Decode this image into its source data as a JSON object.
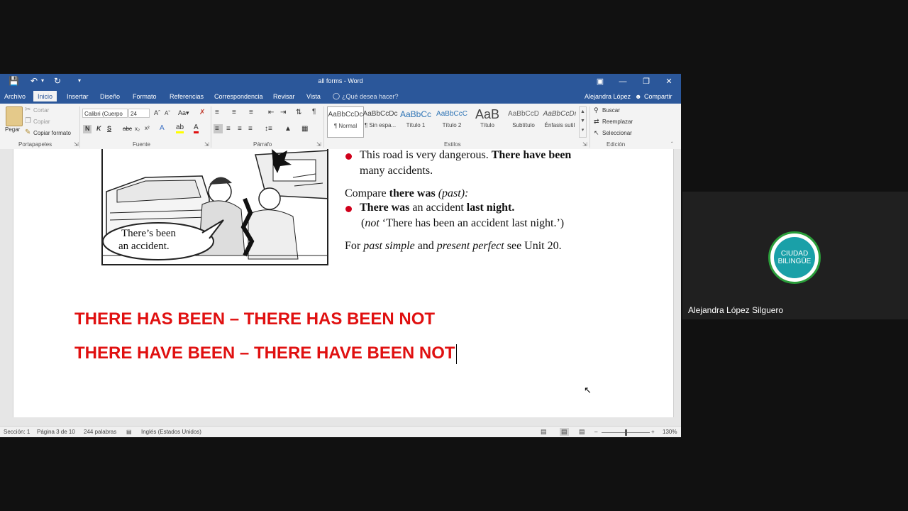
{
  "window": {
    "title": "all forms - Word"
  },
  "tabs": [
    "Archivo",
    "Inicio",
    "Insertar",
    "Diseño",
    "Formato",
    "Referencias",
    "Correspondencia",
    "Revisar",
    "Vista"
  ],
  "tell_me": "¿Qué desea hacer?",
  "user": "Alejandra López",
  "share": "Compartir",
  "ribbon": {
    "clipboard": {
      "paste": "Pegar",
      "cut": "Cortar",
      "copy": "Copiar",
      "format_painter": "Copiar formato",
      "label": "Portapapeles"
    },
    "font": {
      "name": "Calibri (Cuerpo",
      "size": "24",
      "label": "Fuente"
    },
    "paragraph": {
      "label": "Párrafo"
    },
    "styles": {
      "label": "Estilos",
      "items": [
        {
          "sample": "AaBbCcDc",
          "name": "¶ Normal"
        },
        {
          "sample": "AaBbCcDc",
          "name": "¶ Sin espa..."
        },
        {
          "sample": "AaBbCc",
          "name": "Título 1"
        },
        {
          "sample": "AaBbCcC",
          "name": "Título 2"
        },
        {
          "sample": "AaB",
          "name": "Título"
        },
        {
          "sample": "AaBbCcD",
          "name": "Subtítulo"
        },
        {
          "sample": "AaBbCcDı",
          "name": "Énfasis sutil"
        }
      ]
    },
    "editing": {
      "find": "Buscar",
      "replace": "Reemplazar",
      "select": "Seleccionar",
      "label": "Edición"
    }
  },
  "document": {
    "cartoon_caption_1": "There’s been",
    "cartoon_caption_2": "an accident.",
    "text_line_1a": "This road is very dangerous.",
    "text_line_1b": "There have been",
    "text_line_2": "many accidents.",
    "compare_a": "Compare",
    "compare_b": "there was",
    "compare_c": "(past):",
    "text_line_3a": "There was",
    "text_line_3b": "an accident",
    "text_line_3c": "last night.",
    "text_line_4a": "(",
    "text_line_4b": "not",
    "text_line_4c": "‘There has been an accident last night.’)",
    "for_a": "For",
    "for_b": "past simple",
    "for_c": "and",
    "for_d": "present perfect",
    "for_e": "see Unit 20.",
    "red_line_1": "THERE HAS BEEN – THERE HAS BEEN NOT",
    "red_line_2": "THERE HAVE BEEN – THERE HAVE BEEN NOT"
  },
  "status": {
    "section": "Sección: 1",
    "page": "Página 3 de 10",
    "words": "244 palabras",
    "language": "Inglés (Estados Unidos)",
    "zoom": "130%"
  },
  "participant": {
    "name": "Alejandra López Silguero",
    "logo_text_1": "CIUDAD",
    "logo_text_2": "BILINGÜE"
  },
  "colors": {
    "word_blue": "#2b579a",
    "red_text": "#e01010",
    "logo_green": "#2a9d3a"
  }
}
